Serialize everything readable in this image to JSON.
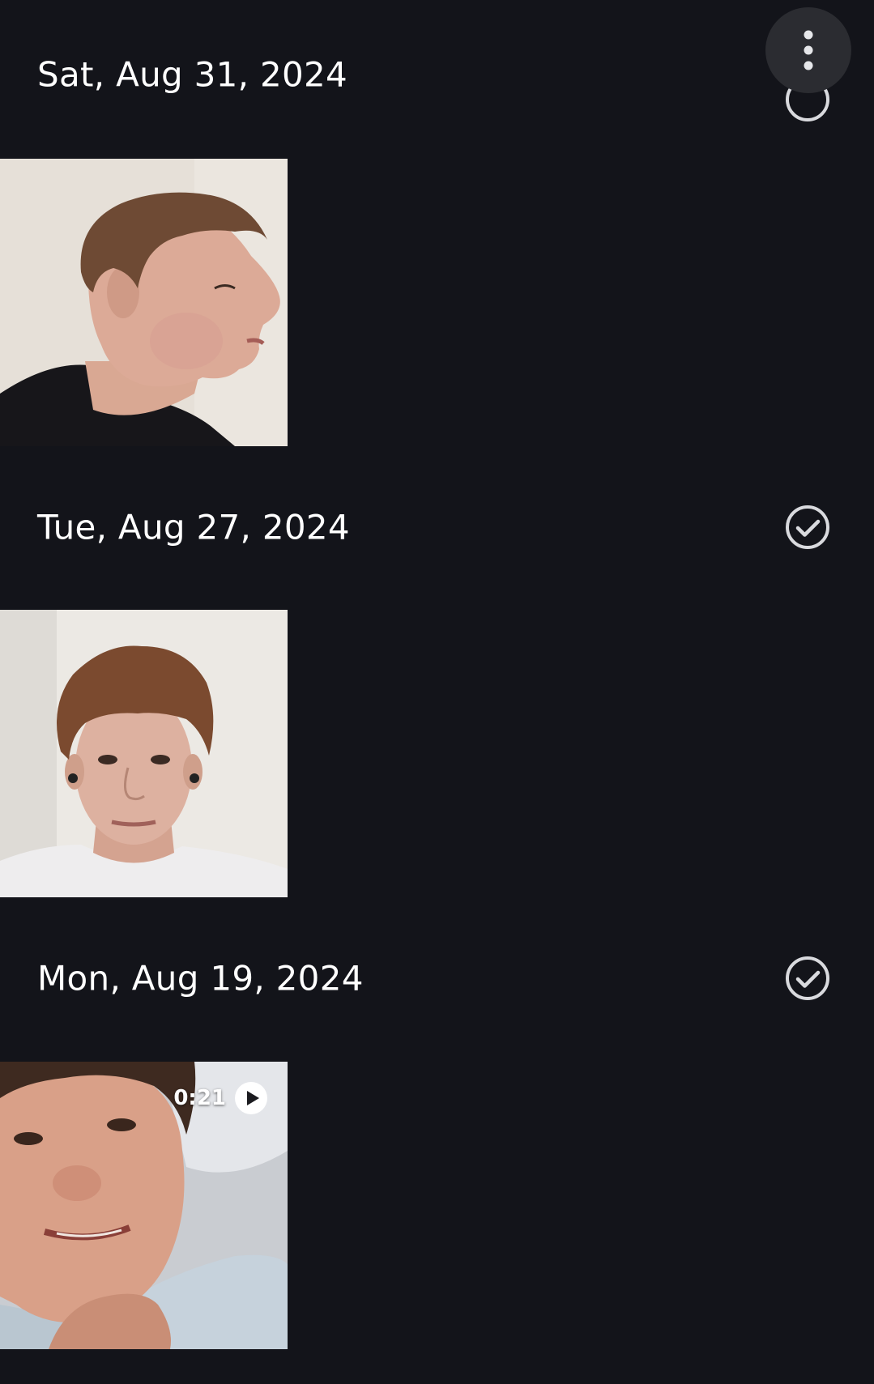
{
  "header": {
    "overflow_icon": "more-vert-icon"
  },
  "groups": [
    {
      "date": "Sat, Aug 31, 2024",
      "selected_icon": "check-circle-icon",
      "items": [
        {
          "type": "photo",
          "subject": "profile-selfie"
        }
      ]
    },
    {
      "date": "Tue, Aug 27, 2024",
      "selected_icon": "check-circle-icon",
      "items": [
        {
          "type": "photo",
          "subject": "front-selfie"
        }
      ]
    },
    {
      "date": "Mon, Aug 19, 2024",
      "selected_icon": "check-circle-icon",
      "items": [
        {
          "type": "video",
          "duration": "0:21",
          "play_icon": "play-circle-icon"
        }
      ]
    }
  ],
  "colors": {
    "background": "#13141a",
    "overflow_button_bg": "#2b2c31",
    "check_outline": "#d9dade",
    "text": "#ffffff"
  }
}
